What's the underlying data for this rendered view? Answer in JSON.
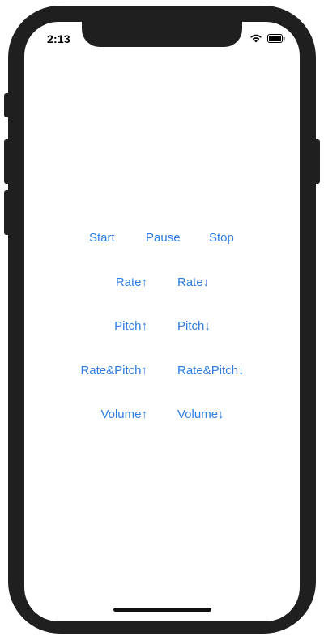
{
  "status_bar": {
    "time": "2:13",
    "icons": [
      "wifi-icon",
      "battery-icon"
    ]
  },
  "accent_color": "#2f7de1",
  "controls": {
    "row1": [
      "Start",
      "Pause",
      "Stop"
    ],
    "row2": [
      "Rate↑",
      "Rate↓"
    ],
    "row3": [
      "Pitch↑",
      "Pitch↓"
    ],
    "row4": [
      "Rate&Pitch↑",
      "Rate&Pitch↓"
    ],
    "row5": [
      "Volume↑",
      "Volume↓"
    ]
  }
}
